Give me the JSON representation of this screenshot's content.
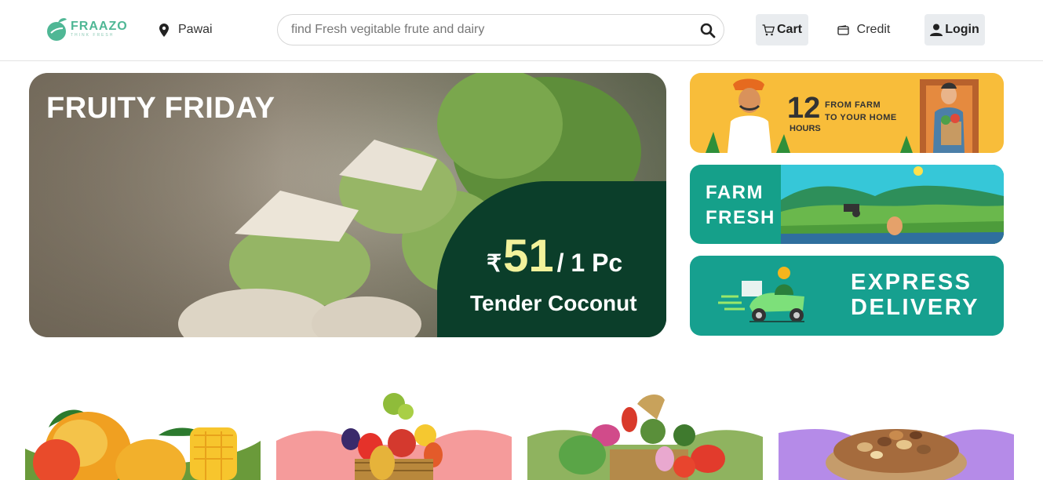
{
  "header": {
    "brand_name": "FRAAZO",
    "brand_tagline": "THINK FRESH",
    "location": "Pawai",
    "search": {
      "placeholder": "find Fresh vegitable frute and dairy"
    },
    "cart_label": "Cart",
    "credit_label": "Credit",
    "login_label": "Login"
  },
  "hero": {
    "title": "FRUITY FRIDAY",
    "currency": "₹",
    "price": "51",
    "unit": "/ 1 Pc",
    "product": "Tender Coconut"
  },
  "banners": {
    "delivery": {
      "number": "12",
      "unit": "HOURS",
      "line1": "FROM FARM",
      "line2": "TO YOUR HOME"
    },
    "farm": {
      "line1": "FARM",
      "line2": "FRESH"
    },
    "express": {
      "line1": "EXPRESS",
      "line2": "DELIVERY"
    }
  },
  "categories": [
    {
      "icon": "mango-icon",
      "accent": "#6a9a3a"
    },
    {
      "icon": "fruit-basket-icon",
      "accent": "#f59b9b"
    },
    {
      "icon": "vegetable-basket-icon",
      "accent": "#8fb35f"
    },
    {
      "icon": "dry-fruits-icon",
      "accent": "#b58be8"
    }
  ],
  "colors": {
    "brand": "#4fb795",
    "hero_badge": "#0b3e2a",
    "price_highlight": "#f3f29b",
    "banner_yellow": "#f8bd3a",
    "banner_teal": "#16a08f"
  }
}
